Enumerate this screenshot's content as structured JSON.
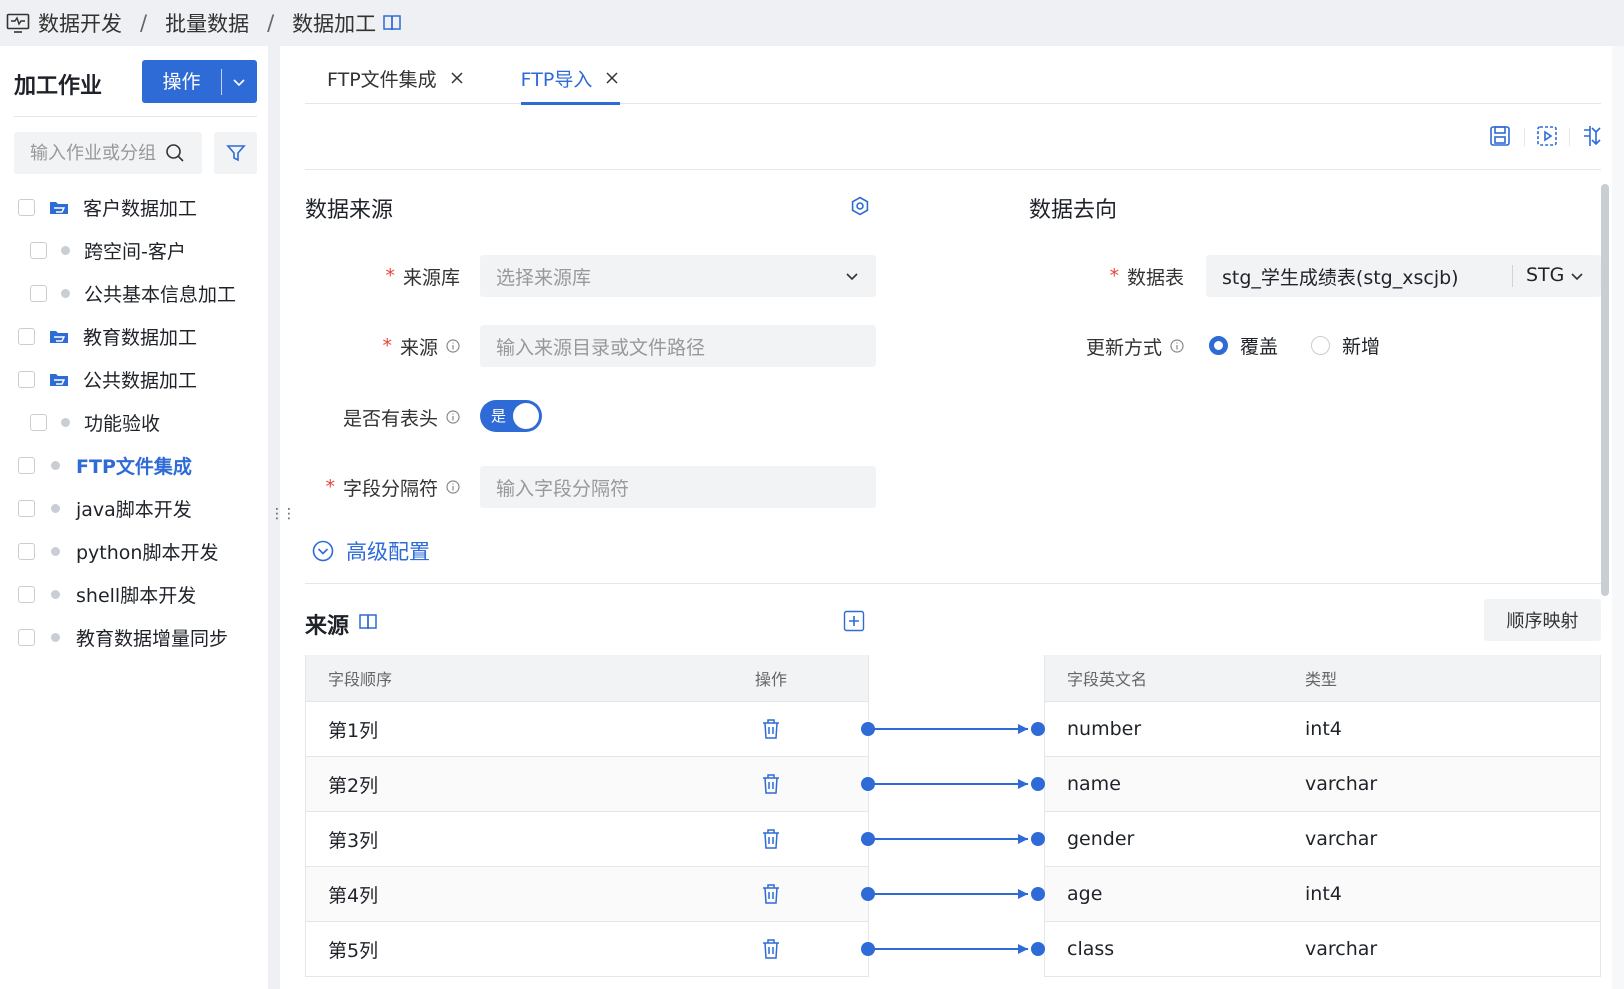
{
  "breadcrumb": {
    "items": [
      "数据开发",
      "批量数据",
      "数据加工"
    ],
    "separator": "/"
  },
  "sidebar": {
    "title": "加工作业",
    "op_button": "操作",
    "search_placeholder": "输入作业或分组",
    "items": [
      {
        "label": "客户数据加工",
        "kind": "folder"
      },
      {
        "label": "跨空间-客户",
        "kind": "job"
      },
      {
        "label": "公共基本信息加工",
        "kind": "job"
      },
      {
        "label": "教育数据加工",
        "kind": "folder"
      },
      {
        "label": "公共数据加工",
        "kind": "folder"
      },
      {
        "label": "功能验收",
        "kind": "job"
      },
      {
        "label": "FTP文件集成",
        "kind": "job",
        "active": true
      },
      {
        "label": "java脚本开发",
        "kind": "job"
      },
      {
        "label": "python脚本开发",
        "kind": "job"
      },
      {
        "label": "shell脚本开发",
        "kind": "job"
      },
      {
        "label": "教育数据增量同步",
        "kind": "job"
      }
    ]
  },
  "tabs": [
    {
      "label": "FTP文件集成",
      "active": false
    },
    {
      "label": "FTP导入",
      "active": true
    }
  ],
  "toolbar": {
    "icons": [
      "save-icon",
      "run-icon",
      "structure-icon"
    ]
  },
  "source": {
    "title": "数据来源",
    "fields": {
      "source_db": {
        "label": "来源库",
        "placeholder": "选择来源库"
      },
      "source_path": {
        "label": "来源",
        "placeholder": "输入来源目录或文件路径"
      },
      "has_header": {
        "label": "是否有表头",
        "value": "是"
      },
      "delimiter": {
        "label": "字段分隔符",
        "placeholder": "输入字段分隔符"
      }
    },
    "advanced": "高级配置"
  },
  "target": {
    "title": "数据去向",
    "table": {
      "label": "数据表",
      "value": "stg_学生成绩表(stg_xscjb)",
      "schema": "STG"
    },
    "update_mode": {
      "label": "更新方式",
      "options": [
        "覆盖",
        "新增"
      ],
      "selected": "覆盖"
    }
  },
  "mapping": {
    "title": "来源",
    "order_button": "顺序映射",
    "source_headers": [
      "字段顺序",
      "操作"
    ],
    "target_headers": [
      "字段英文名",
      "类型"
    ],
    "source_rows": [
      "第1列",
      "第2列",
      "第3列",
      "第4列",
      "第5列"
    ],
    "target_rows": [
      {
        "name": "number",
        "type": "int4"
      },
      {
        "name": "name",
        "type": "varchar"
      },
      {
        "name": "gender",
        "type": "varchar"
      },
      {
        "name": "age",
        "type": "int4"
      },
      {
        "name": "class",
        "type": "varchar"
      }
    ]
  },
  "colors": {
    "primary": "#2f6bd6",
    "required": "#e8453c"
  }
}
